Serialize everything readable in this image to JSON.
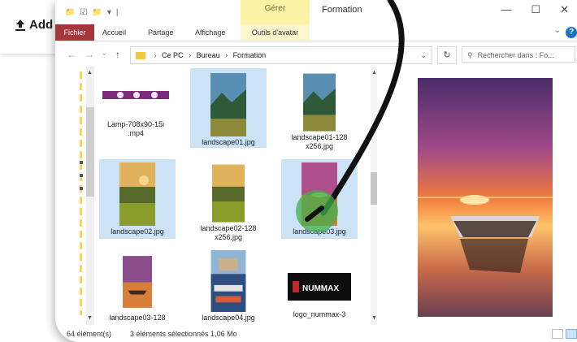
{
  "page_button": {
    "label": "Add l"
  },
  "window": {
    "quick_access": [
      "📁",
      "☑",
      "📁",
      "▾",
      "|"
    ],
    "context_tab": "Gérer",
    "title": "Formation",
    "controls": {
      "minimize": "—",
      "maximize": "☐",
      "close": "✕"
    }
  },
  "ribbon": {
    "tabs": [
      "Fichier",
      "Accueil",
      "Partage",
      "Affichage",
      "Outils d'avatar"
    ],
    "collapse": "⌄",
    "help": "?"
  },
  "navigation": {
    "back": "←",
    "forward": "→",
    "recent": "⌄",
    "up": "↑"
  },
  "address": {
    "segments": [
      "Ce PC",
      "Bureau",
      "Formation"
    ],
    "separator": "›",
    "dropdown": "⌄",
    "refresh": "↻"
  },
  "search": {
    "placeholder": "Rechercher dans : Fo..."
  },
  "files": [
    {
      "name_line1": "Lamp-708x90-15i",
      "name_line2": ".mp4",
      "selected": false,
      "kind": "lamp"
    },
    {
      "name_line1": "landscape01.jpg",
      "name_line2": "",
      "selected": true,
      "kind": "landscape"
    },
    {
      "name_line1": "landscape01-128",
      "name_line2": "x256.jpg",
      "selected": false,
      "kind": "landscape"
    },
    {
      "name_line1": "landscape02.jpg",
      "name_line2": "",
      "selected": true,
      "kind": "meadow"
    },
    {
      "name_line1": "landscape02-128",
      "name_line2": "x256.jpg",
      "selected": false,
      "kind": "meadow"
    },
    {
      "name_line1": "landscape03.jpg",
      "name_line2": "",
      "selected": true,
      "kind": "sunset"
    },
    {
      "name_line1": "landscape03-128",
      "name_line2": "",
      "selected": false,
      "kind": "sunset"
    },
    {
      "name_line1": "landscape04.jpg",
      "name_line2": "",
      "selected": false,
      "kind": "boats"
    },
    {
      "name_line1": "logo_nummax-3",
      "name_line2": "",
      "selected": false,
      "kind": "logo"
    }
  ],
  "logo_text": "NUMMAX",
  "status": {
    "count": "64 élément(s)",
    "selection": "3 éléments sélectionnés  1,06 Mo"
  },
  "colors": {
    "file_tab": "#a4373a",
    "context_tab": "#fbf2a6",
    "selection": "#cce3f7",
    "cursor_highlight": "#3db04f",
    "pen_stroke": "#111111"
  }
}
